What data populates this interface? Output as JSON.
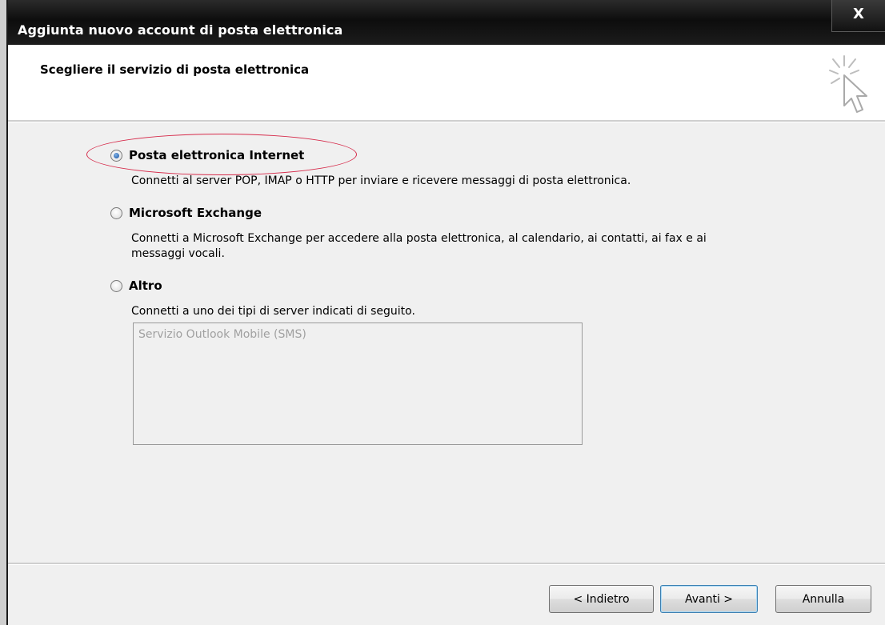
{
  "window": {
    "title": "Aggiunta nuovo account di posta elettronica",
    "close_label": "X"
  },
  "header": {
    "title": "Scegliere il servizio di posta elettronica",
    "icon": "wizard-cursor-icon"
  },
  "options": [
    {
      "label": "Posta elettronica Internet",
      "description": "Connetti al server POP, IMAP o HTTP per inviare e ricevere messaggi di posta elettronica.",
      "selected": true
    },
    {
      "label": "Microsoft Exchange",
      "description_line1": "Connetti a Microsoft Exchange per accedere alla posta elettronica, al calendario, ai contatti, ai fax e ai",
      "description_line2": "messaggi vocali.",
      "selected": false
    },
    {
      "label": "Altro",
      "description": "Connetti a uno dei tipi di server indicati di seguito.",
      "selected": false
    }
  ],
  "server_list": {
    "items": [
      "Servizio Outlook Mobile (SMS)"
    ],
    "enabled": false
  },
  "buttons": {
    "back": "< Indietro",
    "next": "Avanti >",
    "cancel": "Annulla"
  },
  "colors": {
    "annotation": "#d62a4a",
    "titlebar": "#0d0d0d",
    "dialog_bg": "#f0f0f0"
  }
}
